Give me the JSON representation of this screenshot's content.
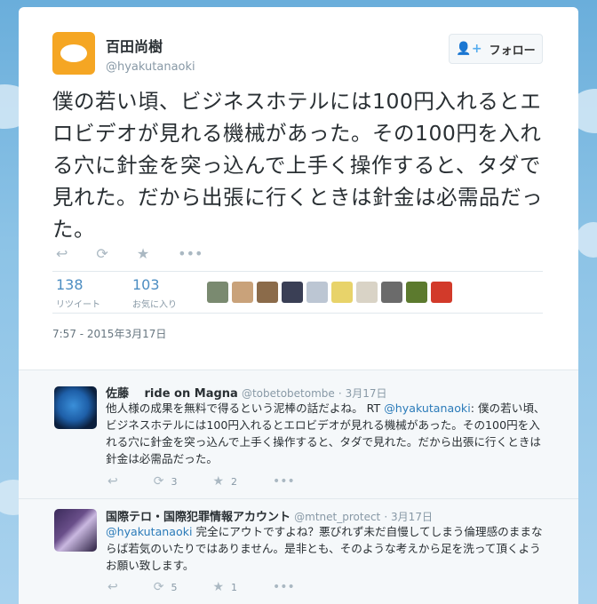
{
  "author": {
    "name": "百田尚樹",
    "handle": "@hyakutanaoki"
  },
  "follow_button": {
    "label": "フォロー",
    "icon": "add-user-icon"
  },
  "tweet": {
    "text": "僕の若い頃、ビジネスホテルには100円入れるとエロビデオが見れる機械があった。その100円を入れる穴に針金を突っ込んで上手く操作すると、タダで見れた。だから出張に行くときは針金は必需品だった。",
    "timestamp": "7:57 - 2015年3月17日",
    "actions": {
      "reply_icon": "reply-icon",
      "retweet_icon": "retweet-icon",
      "favorite_icon": "star-icon",
      "more_icon": "more-icon"
    }
  },
  "stats": {
    "retweets": {
      "count": "138",
      "label": "リツイート"
    },
    "favorites": {
      "count": "103",
      "label": "お気に入り"
    }
  },
  "favoriters": [
    "#7a8a70",
    "#c9a27a",
    "#8b6b4a",
    "#3a3f55",
    "#bcc6d3",
    "#e8d36a",
    "#d9d3c6",
    "#6b6b6b",
    "#5c7a2e",
    "#d23a2a"
  ],
  "replies": [
    {
      "name": "佐藤　 ride on Magna",
      "handle": "@tobetobetombe",
      "date": "3月17日",
      "text_before": "他人様の成果を無料で得るという泥棒の話だよね。 RT ",
      "mention": "@hyakutanaoki",
      "text_after": ": 僕の若い頃、ビジネスホテルには100円入れるとエロビデオが見れる機械があった。その100円を入れる穴に針金を突っ込んで上手く操作すると、タダで見れた。だから出張に行くときは針金は必需品だった。",
      "retweets": "3",
      "favorites": "2"
    },
    {
      "name": "国際テロ・国際犯罪情報アカウント",
      "handle": "@mtnet_protect",
      "date": "3月17日",
      "text_before": "",
      "mention": "@hyakutanaoki",
      "text_after": " 完全にアウトですよね？悪びれず未だ自慢してしまう倫理感のままならば若気のいたりではありません。是非とも、そのような考えから足を洗って頂くようお願い致します。",
      "retweets": "5",
      "favorites": "1"
    }
  ],
  "colors": {
    "accent": "#55acee",
    "link": "#2b7bb9",
    "avatar": "#f5a623"
  }
}
